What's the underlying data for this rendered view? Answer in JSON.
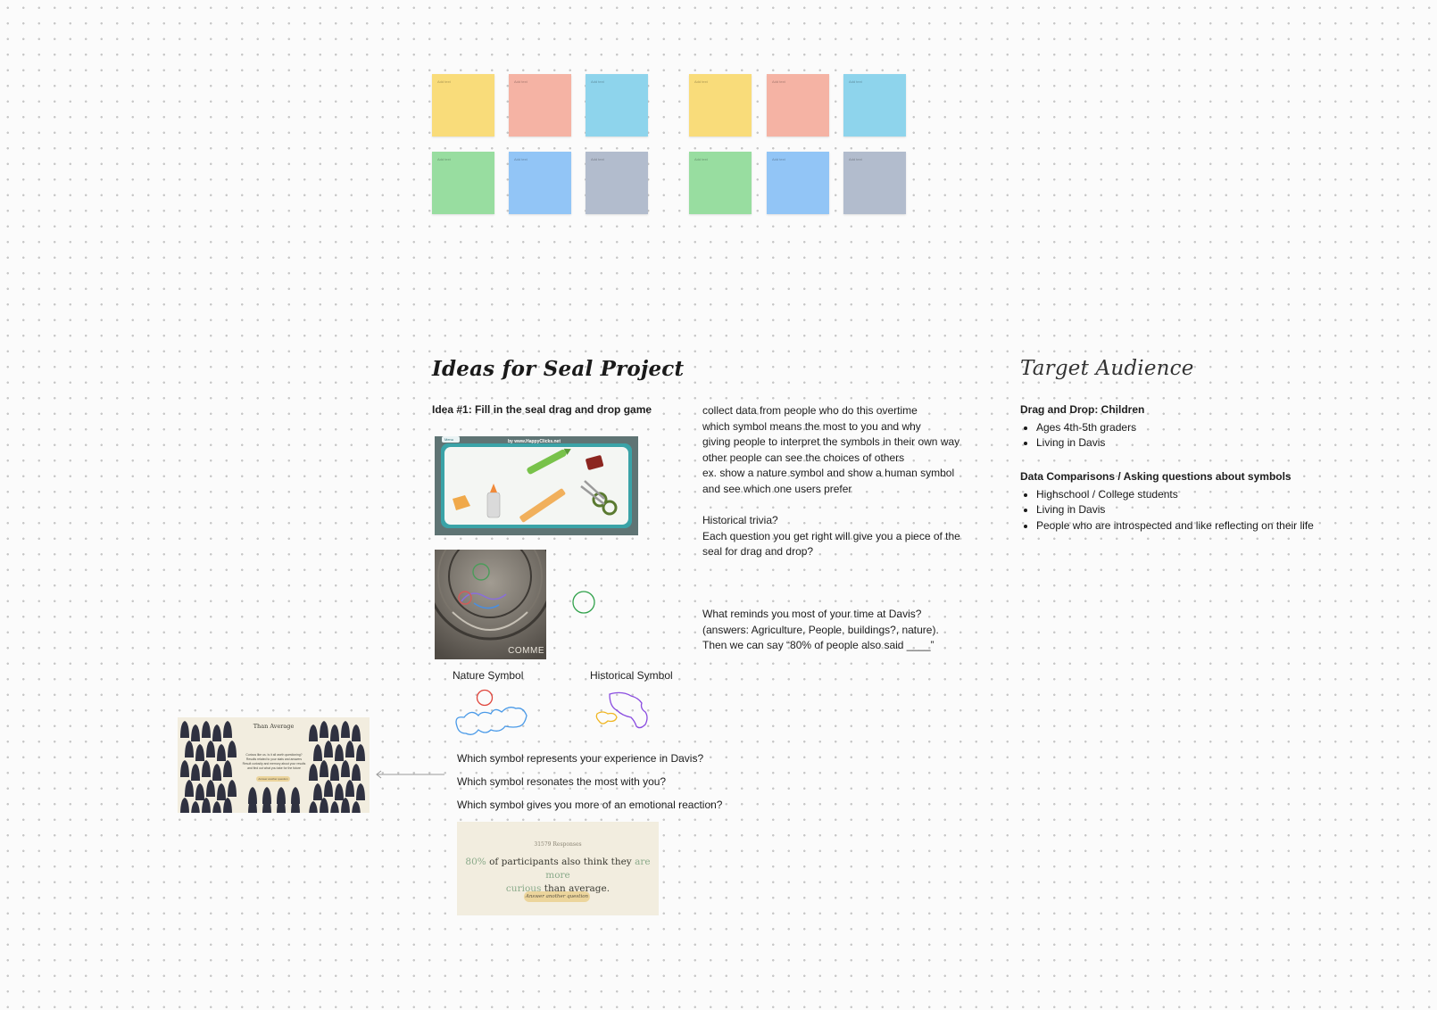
{
  "sticky_placeholder": "Add text",
  "sticky_colors": {
    "yellow": "#f9dc7a",
    "red": "#f5b3a4",
    "cyan": "#8ed4ec",
    "green": "#98dda0",
    "blue": "#92c5f6",
    "gray": "#b2bccd"
  },
  "ideas": {
    "heading": "Ideas for Seal Project",
    "idea1_title": "Idea #1: Fill in the seal drag and drop game",
    "game_banner": "by www.HappyClicks.net",
    "menu_label": "Menu",
    "seal_caption": "COMME",
    "notes": [
      "collect data from people who do this overtime",
      "which symbol means the most to you and why",
      "giving people to interpret the symbols in their own way",
      "other people can see the choices of others",
      "ex. show a nature symbol and show a human symbol",
      "and see which one users prefer"
    ],
    "trivia": [
      "Historical trivia?",
      "Each question you get right will give you a piece of the",
      "seal for drag and drop?"
    ],
    "reminds": [
      "What reminds you most of your time at Davis?",
      "(answers: Agriculture, People, buildings?, nature).",
      "Then we can say “80% of people also said ____”"
    ],
    "nature_label": "Nature Symbol",
    "historical_label": "Historical Symbol",
    "questions": [
      "Which symbol represents your experience in Davis?",
      "Which symbol resonates the most with you?",
      "Which symbol gives you more of an emotional reaction?"
    ]
  },
  "result_card": {
    "responses": "31579 Responses",
    "percent": "80%",
    "text_a": "of participants also think they",
    "highlight_a": "are more",
    "highlight_b": "curious",
    "text_b": "than average.",
    "button": "Answer another question",
    "accent": "#8aaa8a",
    "button_color": "#ecd59c"
  },
  "left_card": {
    "title": "Than Average",
    "body_1": "Curious like us. Is it all worth questioning?",
    "body_2": "Results related to your stats and answers",
    "body_3": "Result curiosity and memory about your results",
    "body_4": "and find out what you take for the future",
    "button": "Answer another question"
  },
  "audience": {
    "heading": "Target Audience",
    "group1_title": "Drag and Drop: Children",
    "group1_items": [
      "Ages 4th-5th graders",
      "Living in Davis"
    ],
    "group2_title": "Data Comparisons / Asking questions about symbols",
    "group2_items": [
      "Highschool / College students",
      "Living in Davis",
      "People who are introspected and like reflecting on their life"
    ]
  }
}
